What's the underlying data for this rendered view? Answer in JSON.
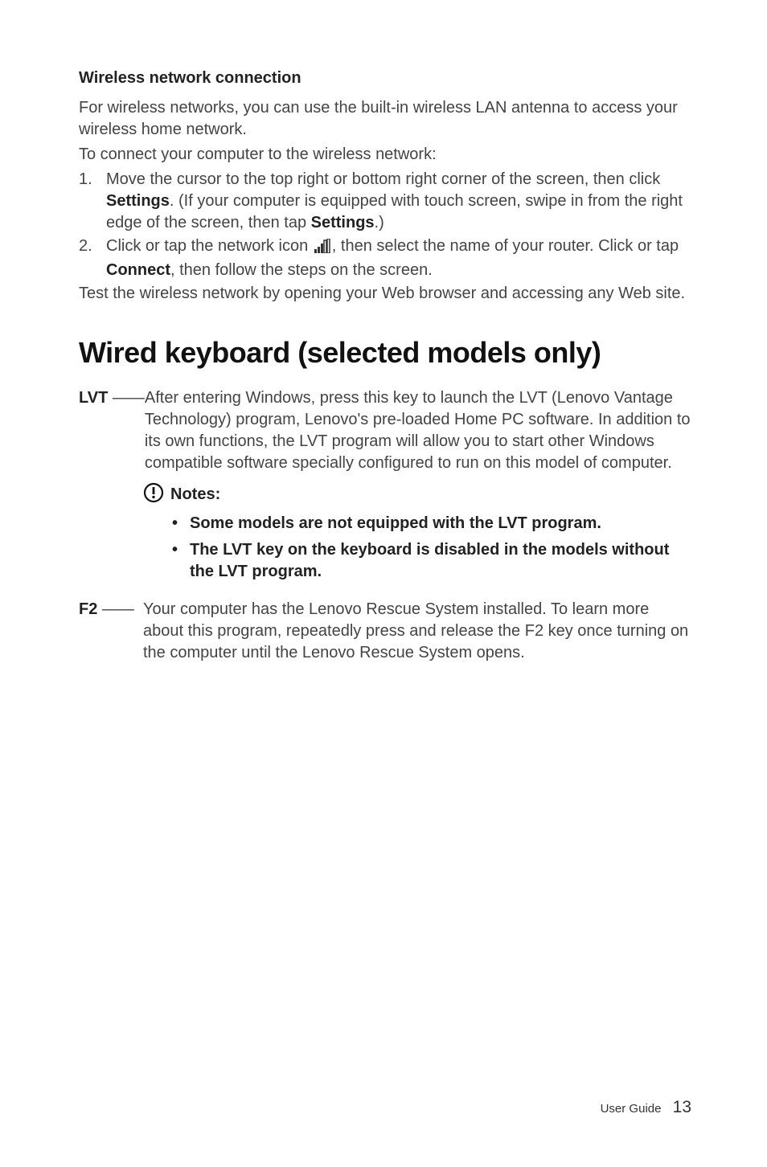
{
  "section1": {
    "heading": "Wireless network connection",
    "para1_line1": "For wireless networks, you can use the built-in wireless LAN antenna to access your wireless home network.",
    "para2": "To connect your computer to the wireless network:",
    "step1_num": "1.",
    "step1_part1": "Move the cursor to the top right or bottom right corner of the screen, then click ",
    "step1_bold1": "Settings",
    "step1_part2": ". (If your computer is equipped with touch screen, swipe in from the right edge of the screen, then tap ",
    "step1_bold2": "Settings",
    "step1_part3": ".)",
    "step2_num": "2.",
    "step2_part1": "Click or tap the network icon ",
    "step2_part2": ", then select the name of your router. Click or tap ",
    "step2_bold1": "Connect",
    "step2_part3": ", then follow the steps on the screen.",
    "para3": "Test the wireless network by opening your Web browser and accessing any Web site."
  },
  "section2": {
    "heading": "Wired keyboard (selected models only)",
    "lvt_key": "LVT",
    "lvt_dash": " —— ",
    "lvt_body": "After entering Windows, press this key to launch the LVT (Lenovo Vantage Technology) program, Lenovo's pre-loaded Home PC software. In addition to its own functions, the LVT program will allow you to start other Windows compatible software specially configured to run on this model of computer.",
    "notes_label": "Notes:",
    "note1": "Some models are not equipped with the LVT program.",
    "note2": "The LVT key on the keyboard is disabled in the models without the LVT program.",
    "f2_key": "F2",
    "f2_dash": "  —— ",
    "f2_body": "Your computer has the Lenovo Rescue System installed. To learn more about this program, repeatedly press and release the F2 key once turning on the computer until the Lenovo Rescue System opens."
  },
  "footer": {
    "label": "User Guide",
    "page": "13"
  }
}
